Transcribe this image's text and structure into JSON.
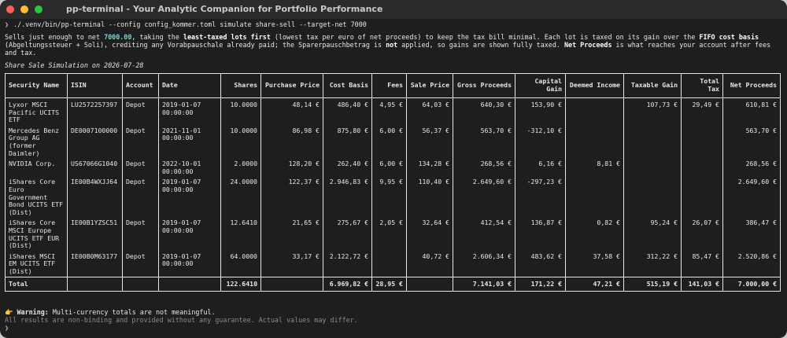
{
  "window": {
    "title": "pp-terminal - Your Analytic Companion for Portfolio Performance"
  },
  "prompt": {
    "caret": "❯",
    "command": "./.venv/bin/pp-terminal --config config_kommer.toml simulate share-sell --target-net 7000"
  },
  "intro": {
    "p1": "Sells just enough to net ",
    "amount": "7000.00",
    "p2": ", taking the ",
    "b1": "least-taxed lots first",
    "p3": " (lowest tax per euro of net proceeds) to keep the tax bill minimal. Each lot is taxed on its gain over the ",
    "b2": "FIFO cost basis",
    "p4": " (Abgeltungssteuer + Soli), crediting any Vorabpauschale already paid; the Sparerpauschbetrag is ",
    "b3": "not",
    "p5": " applied, so gains are shown fully taxed. ",
    "b4": "Net Proceeds",
    "p6": " is what reaches your account after fees and tax."
  },
  "subtitle": "Share Sale Simulation on 2026-07-28",
  "table": {
    "headers": [
      "Security Name",
      "ISIN",
      "Account",
      "Date",
      "Shares",
      "Purchase Price",
      "Cost Basis",
      "Fees",
      "Sale Price",
      "Gross Proceeds",
      "Capital Gain",
      "Deemed Income",
      "Taxable Gain",
      "Total Tax",
      "Net Proceeds"
    ],
    "rows": [
      [
        "Lyxor MSCI Pacific UCITS ETF",
        "LU2572257397",
        "Depot",
        "2019-01-07 00:00:00",
        "10.0000",
        "48,14 €",
        "486,40 €",
        "4,95 €",
        "64,03 €",
        "640,30 €",
        "153,90 €",
        "",
        "107,73 €",
        "29,49 €",
        "610,81 €"
      ],
      [
        "Mercedes Benz Group AG (former Daimler)",
        "DE0007100000",
        "Depot",
        "2021-11-01 00:00:00",
        "10.0000",
        "86,98 €",
        "875,80 €",
        "6,00 €",
        "56,37 €",
        "563,70 €",
        "-312,10 €",
        "",
        "",
        "",
        "563,70 €"
      ],
      [
        "NVIDIA Corp.",
        "US67066G1040",
        "Depot",
        "2022-10-01 00:00:00",
        "2.0000",
        "128,20 €",
        "262,40 €",
        "6,00 €",
        "134,28 €",
        "268,56 €",
        "6,16 €",
        "8,81 €",
        "",
        "",
        "268,56 €"
      ],
      [
        "iShares Core Euro Government Bond UCITS ETF (Dist)",
        "IE00B4WXJJ64",
        "Depot",
        "2019-01-07 00:00:00",
        "24.0000",
        "122,37 €",
        "2.946,83 €",
        "9,95 €",
        "110,40 €",
        "2.649,60 €",
        "-297,23 €",
        "",
        "",
        "",
        "2.649,60 €"
      ],
      [
        "iShares Core MSCI Europe UCITS ETF EUR (Dist)",
        "IE00B1YZSC51",
        "Depot",
        "2019-01-07 00:00:00",
        "12.6410",
        "21,65 €",
        "275,67 €",
        "2,05 €",
        "32,64 €",
        "412,54 €",
        "136,87 €",
        "0,82 €",
        "95,24 €",
        "26,07 €",
        "386,47 €"
      ],
      [
        "iShares MSCI EM UCITS ETF (Dist)",
        "IE00B0M63177",
        "Depot",
        "2019-01-07 00:00:00",
        "64.0000",
        "33,17 €",
        "2.122,72 €",
        "",
        "40,72 €",
        "2.606,34 €",
        "483,62 €",
        "37,58 €",
        "312,22 €",
        "85,47 €",
        "2.520,86 €"
      ]
    ],
    "total": [
      "Total",
      "",
      "",
      "",
      "122.6410",
      "",
      "6.969,82 €",
      "28,95 €",
      "",
      "7.141,03 €",
      "171,22 €",
      "47,21 €",
      "515,19 €",
      "141,03 €",
      "7.000,00 €"
    ]
  },
  "warning": {
    "icon": "👉",
    "label": "Warning:",
    "text": " Multi-currency totals are not meaningful."
  },
  "disclaimer": "All results are non-binding and provided without any guarantee. Actual values may differ.",
  "end_prompt": "❯"
}
